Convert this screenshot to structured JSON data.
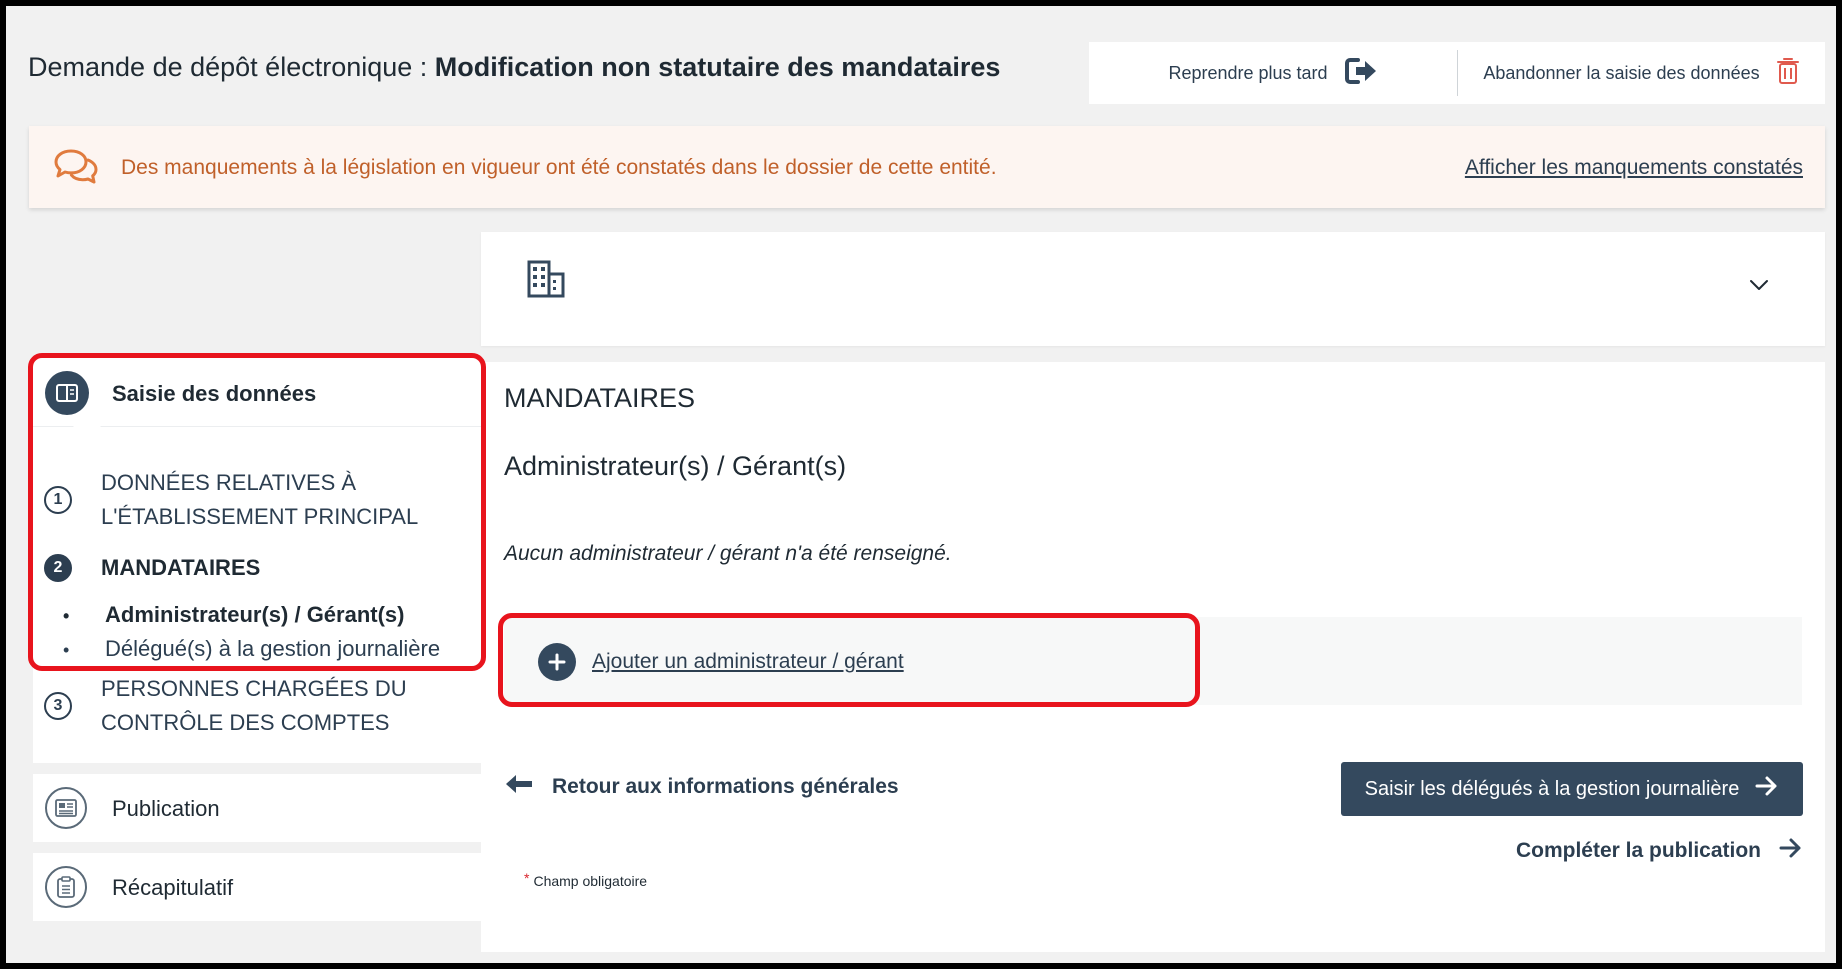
{
  "header": {
    "title_prefix": "Demande de dépôt électronique : ",
    "title_bold": "Modification non statutaire des mandataires",
    "resume_later": "Reprendre plus tard",
    "abandon": "Abandonner la saisie des données"
  },
  "alert": {
    "message": "Des manquements à la législation en vigueur ont été constatés dans le dossier de cette entité.",
    "link": "Afficher les manquements constatés"
  },
  "sidebar": {
    "header": "Saisie des données",
    "steps": [
      {
        "number": "1",
        "label_line1": "DONNÉES RELATIVES À",
        "label_line2": "L'ÉTABLISSEMENT PRINCIPAL"
      },
      {
        "number": "2",
        "label": "MANDATAIRES"
      },
      {
        "number": "3",
        "label_line1": "PERSONNES CHARGÉES DU",
        "label_line2": "CONTRÔLE DES COMPTES"
      }
    ],
    "substeps": [
      "Administrateur(s) / Gérant(s)",
      "Délégué(s) à la gestion journalière"
    ],
    "publication": "Publication",
    "recap": "Récapitulatif"
  },
  "main": {
    "section_title": "MANDATAIRES",
    "sub_title": "Administrateur(s) / Gérant(s)",
    "empty_message": "Aucun administrateur / gérant n'a été renseigné.",
    "add_button": "Ajouter un administrateur / gérant",
    "back_link": "Retour aux informations générales",
    "next_button": "Saisir les délégués à la gestion journalière",
    "complete_link": "Compléter la publication",
    "required_star": "*",
    "required_note": "Champ obligatoire"
  },
  "colors": {
    "primary": "#34495e",
    "alert_bg": "#fdf5f1",
    "alert_text": "#c0602a",
    "highlight": "#e8141d"
  }
}
